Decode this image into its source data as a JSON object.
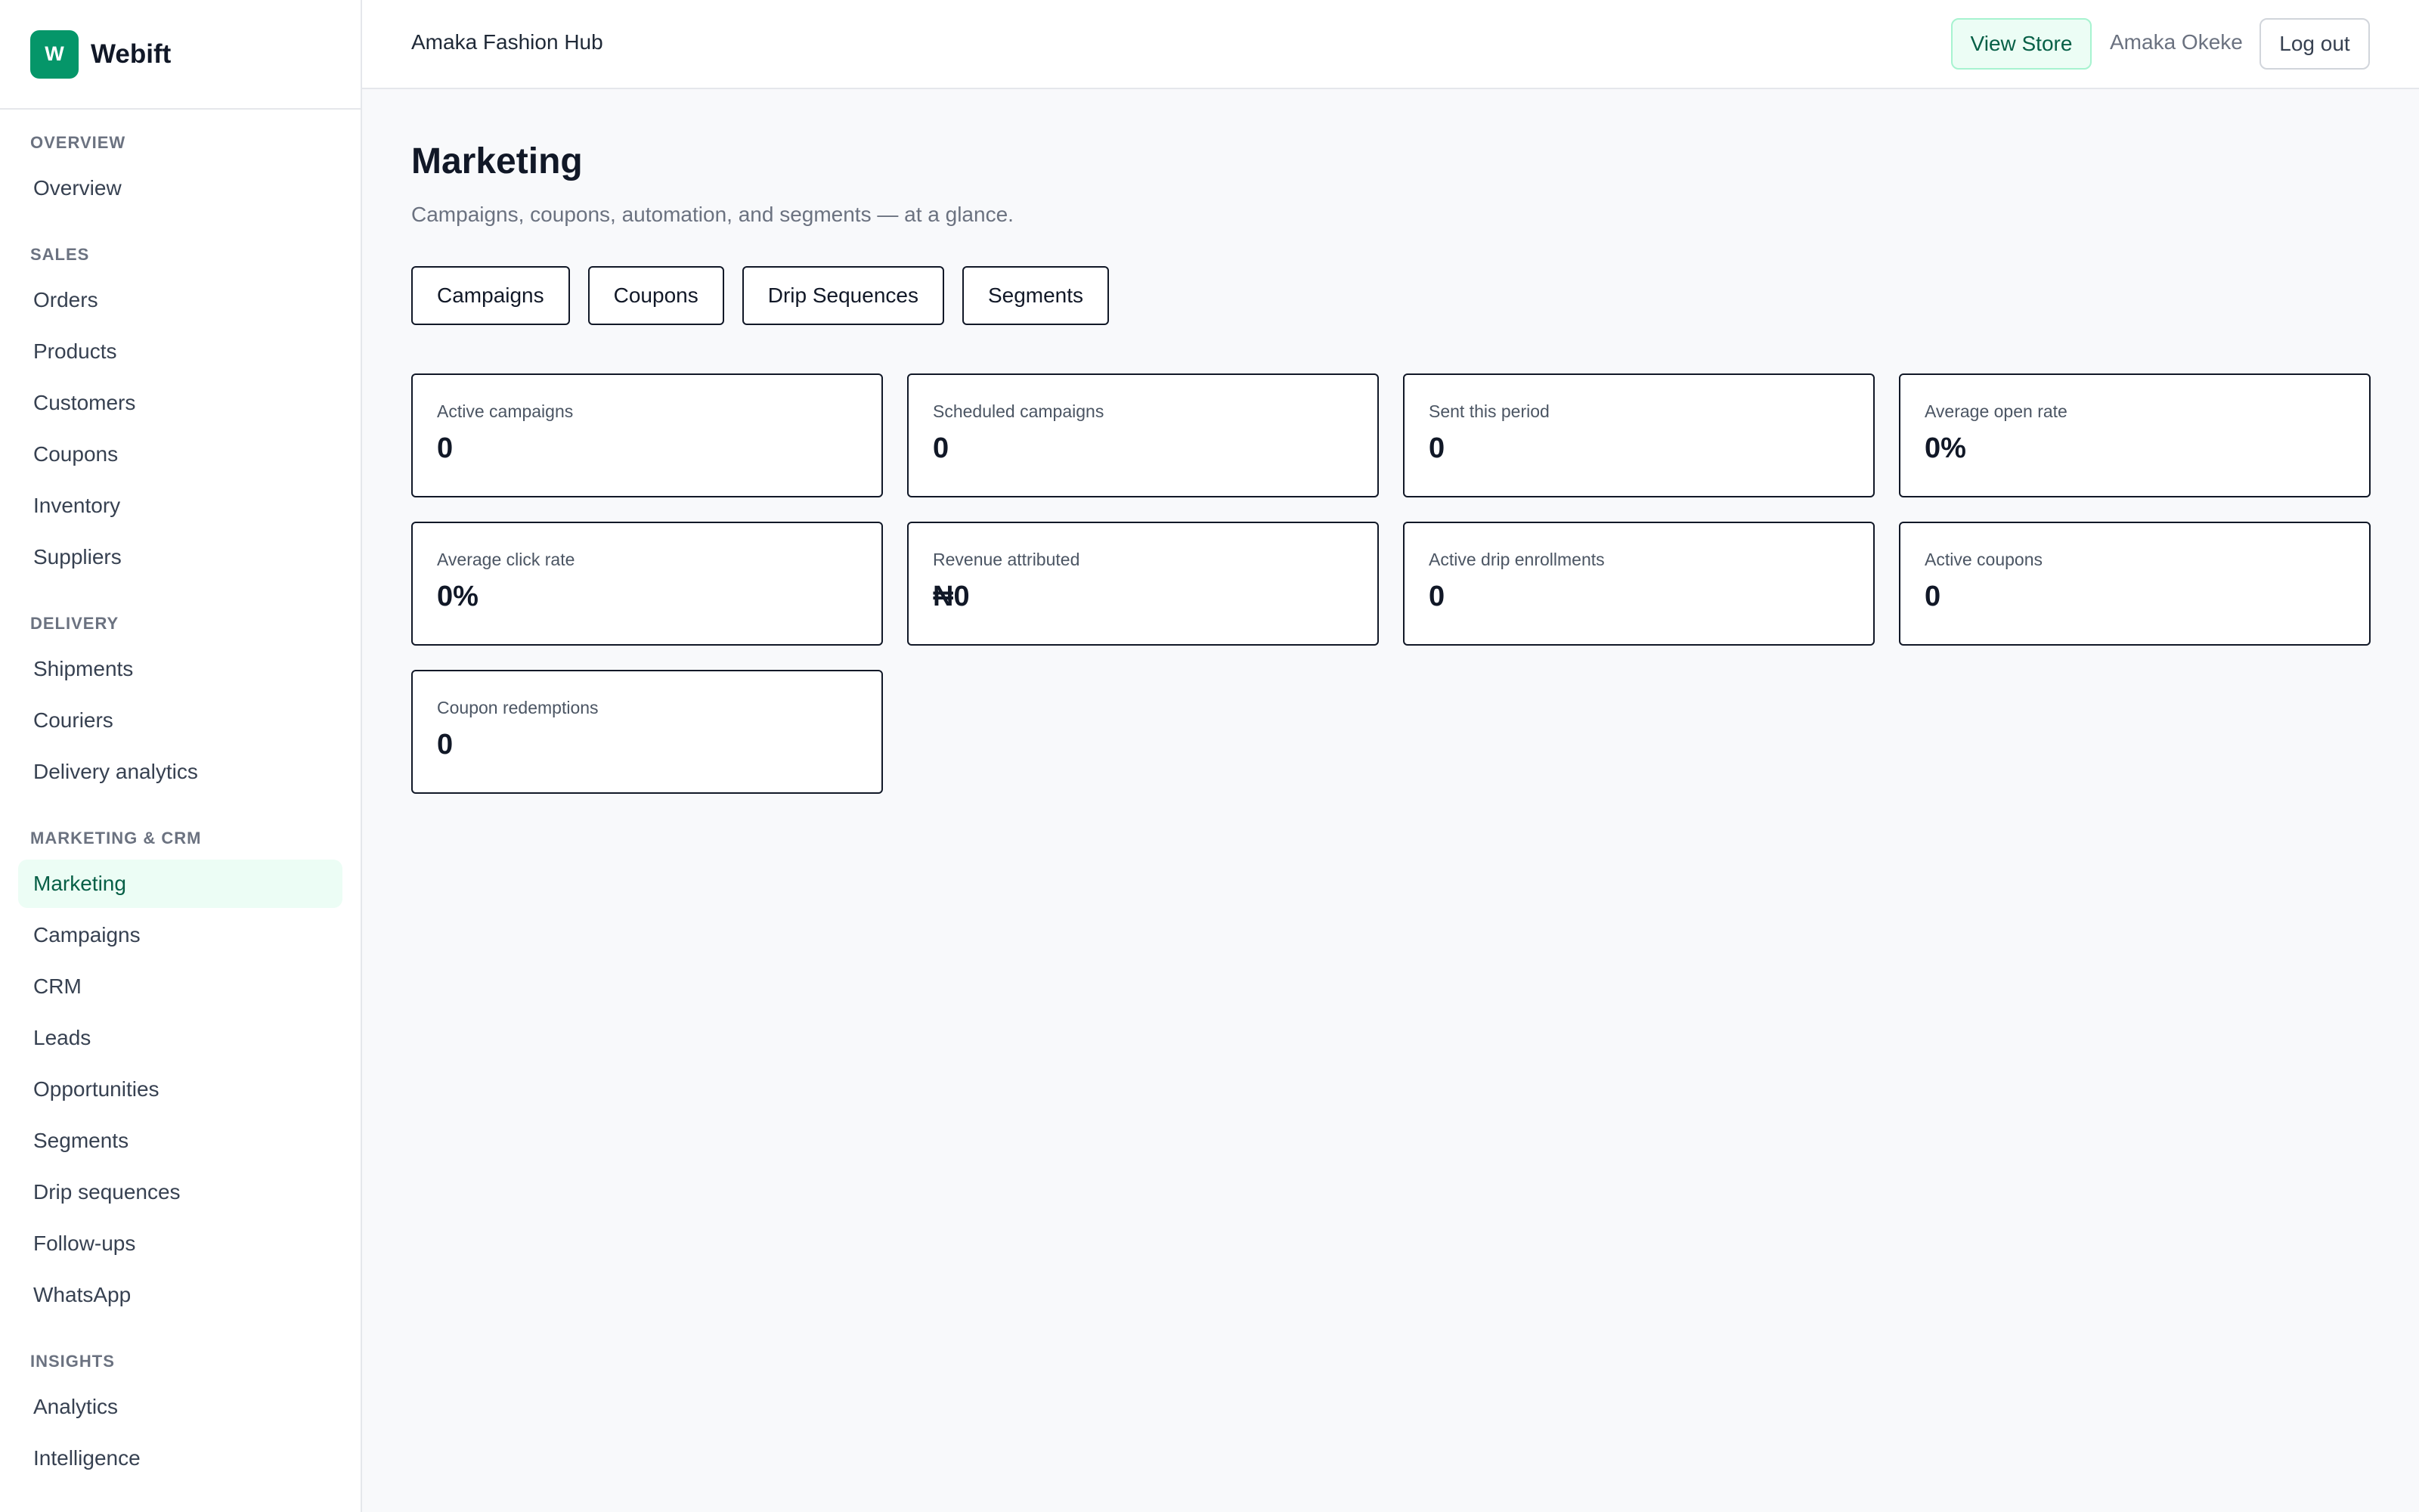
{
  "brand": {
    "logo_letter": "W",
    "name": "Webift",
    "accent": "#059669"
  },
  "sidebar": {
    "sections": [
      {
        "title": "OVERVIEW",
        "items": [
          "Overview"
        ]
      },
      {
        "title": "SALES",
        "items": [
          "Orders",
          "Products",
          "Customers",
          "Coupons",
          "Inventory",
          "Suppliers"
        ]
      },
      {
        "title": "DELIVERY",
        "items": [
          "Shipments",
          "Couriers",
          "Delivery analytics"
        ]
      },
      {
        "title": "MARKETING & CRM",
        "items": [
          "Marketing",
          "Campaigns",
          "CRM",
          "Leads",
          "Opportunities",
          "Segments",
          "Drip sequences",
          "Follow-ups",
          "WhatsApp"
        ]
      },
      {
        "title": "INSIGHTS",
        "items": [
          "Analytics",
          "Intelligence"
        ]
      }
    ],
    "active_item": "Marketing"
  },
  "header": {
    "store_name": "Amaka Fashion Hub",
    "view_store_label": "View Store",
    "user_name": "Amaka Okeke",
    "logout_label": "Log out"
  },
  "main": {
    "title": "Marketing",
    "subtitle": "Campaigns, coupons, automation, and segments — at a glance.",
    "tabs": [
      "Campaigns",
      "Coupons",
      "Drip Sequences",
      "Segments"
    ],
    "stats": [
      {
        "label": "Active campaigns",
        "value": "0"
      },
      {
        "label": "Scheduled campaigns",
        "value": "0"
      },
      {
        "label": "Sent this period",
        "value": "0"
      },
      {
        "label": "Average open rate",
        "value": "0%"
      },
      {
        "label": "Average click rate",
        "value": "0%"
      },
      {
        "label": "Revenue attributed",
        "value": "₦0"
      },
      {
        "label": "Active drip enrollments",
        "value": "0"
      },
      {
        "label": "Active coupons",
        "value": "0"
      },
      {
        "label": "Coupon redemptions",
        "value": "0"
      }
    ]
  }
}
